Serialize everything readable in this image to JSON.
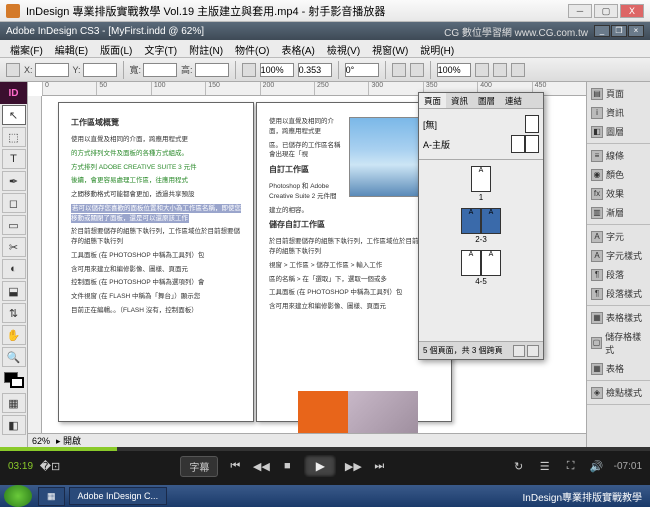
{
  "window": {
    "title": "InDesign 專業排版實戰教學 Vol.19 主版建立與套用.mp4 - 射手影音播放器",
    "min": "─",
    "max": "▢",
    "close": "Ⅹ"
  },
  "app": {
    "title": "Adobe InDesign CS3 - [MyFirst.indd @ 62%]",
    "overlay": "CG 數位學習網 www.CG.com.tw",
    "min": "_",
    "restore": "❐",
    "close": "×"
  },
  "menu": {
    "items": [
      "檔案(F)",
      "編輯(E)",
      "版面(L)",
      "文字(T)",
      "附註(N)",
      "物件(O)",
      "表格(A)",
      "檢視(V)",
      "視窗(W)",
      "說明(H)"
    ]
  },
  "ctrl": {
    "x": "X:",
    "y": "Y:",
    "w": "寬:",
    "h": "高:",
    "rotate": "0°",
    "shear": "0.353",
    "scale": "100%"
  },
  "status": {
    "zoom": "62%",
    "page": "▸ 開啟"
  },
  "tools": [
    "↖",
    "⬚",
    "T",
    "✒",
    "◻",
    "▭",
    "✂",
    "◐",
    "⬓",
    "⇅",
    "✋",
    "🔍"
  ],
  "rightPanels": {
    "g1": [
      "頁面",
      "資訊",
      "圖層"
    ],
    "g2": [
      "線條",
      "顏色",
      "效果",
      "漸層"
    ],
    "g3": [
      "字元",
      "字元樣式",
      "段落",
      "段落樣式"
    ],
    "g4": [
      "表格樣式",
      "儲存格樣式",
      "表格"
    ],
    "g5": [
      "檢點樣式"
    ]
  },
  "pagesPanel": {
    "tabs": [
      "頁面",
      "資訊",
      "圖層",
      "連結"
    ],
    "masters": {
      "none": "[無]",
      "a": "A-主版"
    },
    "spreads": [
      {
        "lbl": "1",
        "pg": [
          "A"
        ]
      },
      {
        "lbl": "2-3",
        "pg": [
          "A",
          "A"
        ],
        "sel": true
      },
      {
        "lbl": "4-5",
        "pg": [
          "A",
          "A"
        ]
      }
    ],
    "status": "5 個頁面，共 3 個跨頁"
  },
  "doc": {
    "heading": "工作區域概覽",
    "p1": "使用以直覺及相同的介面，跨應用程式更",
    "p2": "的方式排列文件及面板的各種方式組成。",
    "p3": "方式排列 ADOBE CREATIVE SUITE 3 元件",
    "p4": "後續，會更容易處理工作區，往應用程式",
    "p5": "之間移動格式可能都會更加，透過共享預設",
    "hl": "若可以儲存您喜歡的面板位置和大小為工作區名稱，即使您移動或關閉了面板，還是可以還原該工作",
    "h2": "自訂工作區",
    "p6": "區。已儲存的工作區名稱會出現在「視",
    "p7": "Photoshop 和 Adobe Creative Suite 2 元件間",
    "p8": "建立的相容。",
    "h3": "儲存自訂工作區",
    "p9": "於目前想要儲存的組態下執行列，工作區域位於目前想要儲存的組態下執行列",
    "p10": "視窗 > 工作區 > 儲存工作區 > 輸入工作",
    "p11": "區的名稱 > 在「選取」下，選取一個或多",
    "p12": "工具面板 (在 PHOTOSHOP 中稱為工具列）包",
    "p13": "含可用來建立和編修影像、圖樣、頁面元",
    "p14": "控制面板 (在 PHOTOSHOP 中稱為選項列）會",
    "p15": "文件視窗 (在 FLASH 中稱為「舞台」）顯示您",
    "p16": "目前正在編輯。。（FLASH 沒有，控制面板）"
  },
  "video": {
    "cur": "03:19",
    "rem": "-07:01",
    "subtitle": "字幕"
  },
  "taskbar": {
    "items": [
      "▦",
      "Adobe InDesign C..."
    ],
    "right": "InDesign專業排版實戰教學"
  },
  "rulermarks": [
    "0",
    "50",
    "100",
    "150",
    "200",
    "250",
    "300",
    "350",
    "400",
    "450"
  ]
}
